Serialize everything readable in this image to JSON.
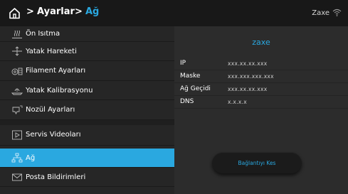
{
  "header": {
    "breadcrumb_sep_1": ">",
    "breadcrumb_settings": "Ayarlar",
    "breadcrumb_sep_2": ">",
    "breadcrumb_current": "Ağ",
    "device_name": "Zaxe",
    "accent_color": "#2aa8e0"
  },
  "sidebar": {
    "items": [
      {
        "label": "Ön Isıtma",
        "icon": "preheat-icon"
      },
      {
        "label": "Yatak Hareketi",
        "icon": "bed-move-icon"
      },
      {
        "label": "Filament Ayarları",
        "icon": "filament-icon"
      },
      {
        "label": "Yatak Kalibrasyonu",
        "icon": "bed-calibration-icon"
      },
      {
        "label": "Nozül Ayarları",
        "icon": "nozzle-icon"
      },
      {
        "label": "Servis Videoları",
        "icon": "play-icon"
      },
      {
        "label": "Ağ",
        "icon": "network-icon",
        "selected": true
      },
      {
        "label": "Posta Bildirimleri",
        "icon": "mail-icon"
      }
    ]
  },
  "network": {
    "name": "zaxe",
    "rows": [
      {
        "key": "IP",
        "value": "xxx.xx.xx.xxx"
      },
      {
        "key": "Maske",
        "value": "xxx.xxx.xxx.xxx"
      },
      {
        "key": "Ağ Geçidi",
        "value": "xxx.xx.xx.xxx"
      },
      {
        "key": "DNS",
        "value": "x.x.x.x"
      }
    ],
    "disconnect_label": "Bağlantıyı Kes"
  }
}
